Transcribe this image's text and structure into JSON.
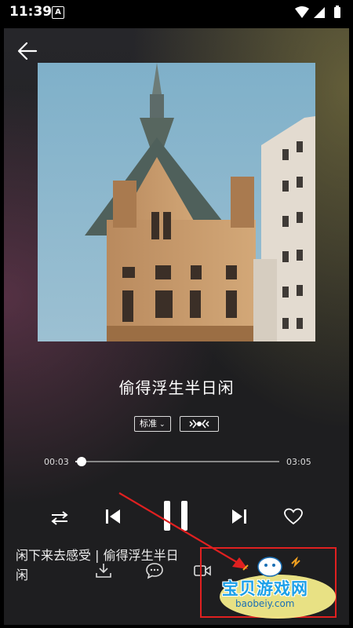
{
  "status_bar": {
    "time": "11:39",
    "notif_badge": "A"
  },
  "player": {
    "song_title": "偷得浮生半日闲",
    "quality_label": "标准",
    "current_time": "00:03",
    "total_time": "03:05",
    "progress": 0.03
  },
  "lyrics": {
    "line1": "闲下来去感受 | 偷得浮生半日",
    "line2": "闲"
  },
  "watermark": {
    "text": "宝贝游戏网",
    "url": "baobeiy.com"
  },
  "icons": {
    "back": "arrow-left-icon",
    "mode": "repeat-icon",
    "prev": "skip-previous-icon",
    "pause": "pause-icon",
    "next": "skip-next-icon",
    "like": "heart-icon",
    "download": "download-icon",
    "comment": "comment-icon",
    "video": "video-icon"
  },
  "colors": {
    "highlight": "#e02020",
    "watermark": "#1ca0e8"
  }
}
